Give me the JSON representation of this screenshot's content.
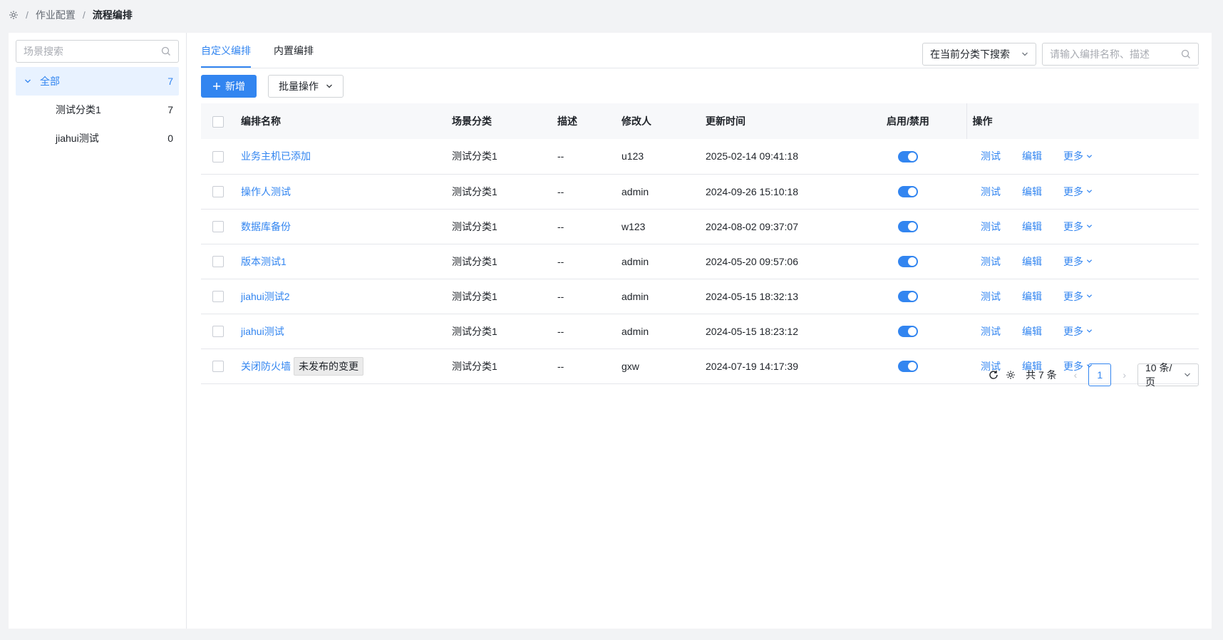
{
  "breadcrumb": {
    "items": [
      "作业配置"
    ],
    "current": "流程编排"
  },
  "sidebar": {
    "search_placeholder": "场景搜索",
    "tree": [
      {
        "label": "全部",
        "count": "7"
      },
      {
        "label": "测试分类1",
        "count": "7"
      },
      {
        "label": "jiahui测试",
        "count": "0"
      }
    ]
  },
  "tabs": [
    "自定义编排",
    "内置编排"
  ],
  "toolbar": {
    "scope_select": "在当前分类下搜索",
    "search_placeholder": "请输入编排名称、描述",
    "add_label": "新增",
    "batch_label": "批量操作"
  },
  "table": {
    "headers": [
      "编排名称",
      "场景分类",
      "描述",
      "修改人",
      "更新时间",
      "启用/禁用",
      "操作"
    ],
    "rows": [
      {
        "name": "业务主机已添加",
        "category": "测试分类1",
        "desc": "--",
        "modifier": "u123",
        "time": "2025-02-14 09:41:18",
        "tag": "",
        "enabled": true
      },
      {
        "name": "操作人测试",
        "category": "测试分类1",
        "desc": "--",
        "modifier": "admin",
        "time": "2024-09-26 15:10:18",
        "tag": "",
        "enabled": true
      },
      {
        "name": "数据库备份",
        "category": "测试分类1",
        "desc": "--",
        "modifier": "w123",
        "time": "2024-08-02 09:37:07",
        "tag": "",
        "enabled": true
      },
      {
        "name": "版本测试1",
        "category": "测试分类1",
        "desc": "--",
        "modifier": "admin",
        "time": "2024-05-20 09:57:06",
        "tag": "",
        "enabled": true
      },
      {
        "name": "jiahui测试2",
        "category": "测试分类1",
        "desc": "--",
        "modifier": "admin",
        "time": "2024-05-15 18:32:13",
        "tag": "",
        "enabled": true
      },
      {
        "name": "jiahui测试",
        "category": "测试分类1",
        "desc": "--",
        "modifier": "admin",
        "time": "2024-05-15 18:23:12",
        "tag": "",
        "enabled": true
      },
      {
        "name": "关闭防火墙",
        "category": "测试分类1",
        "desc": "--",
        "modifier": "gxw",
        "time": "2024-07-19 14:17:39",
        "tag": "未发布的变更",
        "enabled": true
      }
    ],
    "ops": {
      "test": "测试",
      "edit": "编辑",
      "more": "更多"
    }
  },
  "pagination": {
    "total": "共 7 条",
    "current_page": "1",
    "page_size": "10 条/页"
  },
  "colors": {
    "primary": "#3285f0"
  }
}
